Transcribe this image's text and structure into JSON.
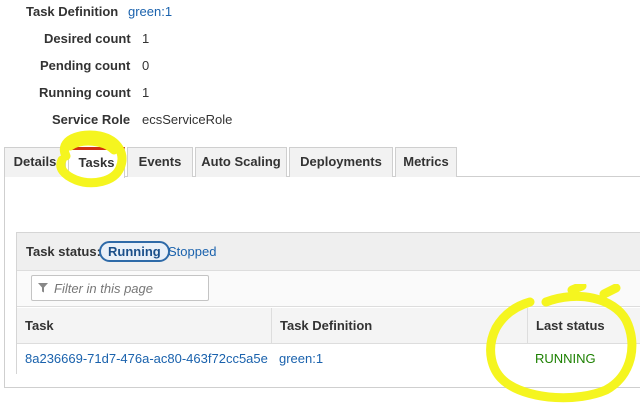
{
  "details": {
    "task_definition": {
      "label": "Task Definition",
      "value": "green:1"
    },
    "desired_count": {
      "label": "Desired count",
      "value": "1"
    },
    "pending_count": {
      "label": "Pending count",
      "value": "0"
    },
    "running_count": {
      "label": "Running count",
      "value": "1"
    },
    "service_role": {
      "label": "Service Role",
      "value": "ecsServiceRole"
    }
  },
  "tabs": [
    {
      "label": "Details"
    },
    {
      "label": "Tasks",
      "active": true
    },
    {
      "label": "Events"
    },
    {
      "label": "Auto Scaling"
    },
    {
      "label": "Deployments"
    },
    {
      "label": "Metrics"
    }
  ],
  "task_status": {
    "label": "Task status:",
    "running": "Running",
    "stopped": "Stopped"
  },
  "filter": {
    "placeholder": "Filter in this page"
  },
  "table": {
    "headers": [
      "Task",
      "Task Definition",
      "Last status"
    ],
    "rows": [
      {
        "task": "8a236669-71d7-476a-ac80-463f72cc5a5e",
        "task_definition": "green:1",
        "last_status": "RUNNING"
      }
    ]
  },
  "colors": {
    "link": "#1a62ad",
    "running_status": "#1d8102",
    "highlight_marker": "#f5f51f",
    "active_tab_accent": "#d13212"
  }
}
